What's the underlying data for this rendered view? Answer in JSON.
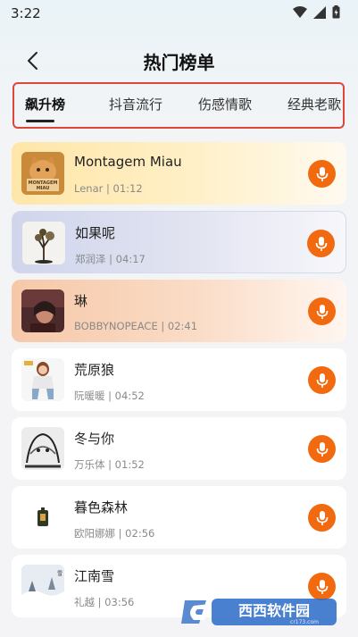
{
  "status": {
    "time": "3:22"
  },
  "header": {
    "title": "热门榜单"
  },
  "tabs": [
    {
      "label": "飙升榜",
      "active": true
    },
    {
      "label": "抖音流行",
      "active": false
    },
    {
      "label": "伤感情歌",
      "active": false
    },
    {
      "label": "经典老歌",
      "active": false
    }
  ],
  "songs": [
    {
      "title": "Montagem Miau",
      "meta": "Lenar | 01:12"
    },
    {
      "title": "如果呢",
      "meta": "郑润泽 | 04:17"
    },
    {
      "title": "琳",
      "meta": "BOBBYNOPEACE | 02:41"
    },
    {
      "title": "荒原狼",
      "meta": "阮暖暖 | 04:52"
    },
    {
      "title": "冬与你",
      "meta": "万乐体 | 01:52"
    },
    {
      "title": "暮色森林",
      "meta": "欧阳娜娜 | 02:56"
    },
    {
      "title": "江南雪",
      "meta": "礼越 | 03:56"
    }
  ],
  "covers": [
    {
      "lettering": "MONTAGEM MIAU"
    },
    {},
    {},
    {},
    {},
    {},
    {}
  ],
  "watermark": {
    "brand": "西西软件园",
    "domain": "cr173.com"
  },
  "colors": {
    "accent": "#f26a10",
    "highlight_border": "#e0453a"
  }
}
